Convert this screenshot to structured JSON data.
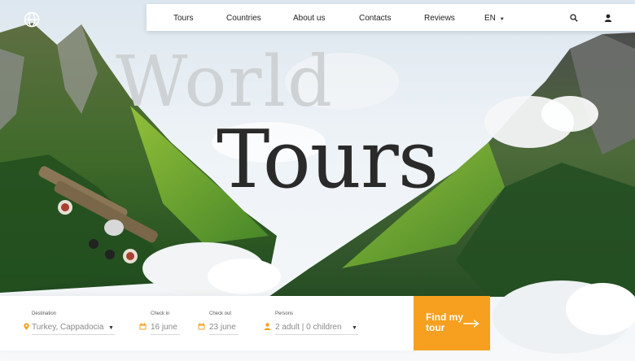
{
  "nav": {
    "items": [
      "Tours",
      "Countries",
      "About us",
      "Contacts",
      "Reviews"
    ],
    "language": "EN"
  },
  "hero": {
    "title_line1": "World",
    "title_line2": "Tours"
  },
  "search": {
    "destination": {
      "label": "Destination",
      "value": "Turkey, Cappadocia"
    },
    "checkin": {
      "label": "Check in",
      "value": "16 june"
    },
    "checkout": {
      "label": "Check out",
      "value": "23 june"
    },
    "persons": {
      "label": "Persons",
      "value": "2 adult | 0 children"
    },
    "button_label": "Find my tour"
  },
  "colors": {
    "accent": "#f7a01f",
    "title_dark": "#2a2a2a",
    "title_light": "#cfd2d4"
  },
  "icons": {
    "logo": "globe-icon",
    "search": "search-icon",
    "user": "user-icon",
    "pin": "location-pin-icon",
    "calendar": "calendar-icon",
    "person": "person-icon",
    "arrow": "arrow-right-icon"
  }
}
